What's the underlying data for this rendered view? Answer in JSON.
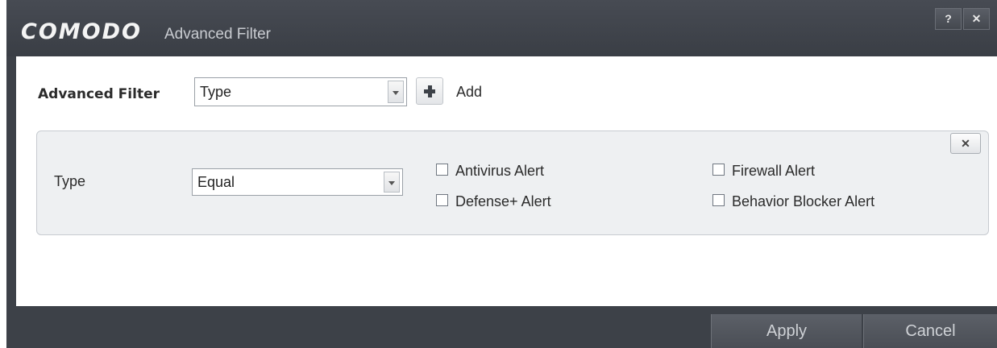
{
  "title": {
    "brand": "COMODO",
    "subtitle": "Advanced Filter",
    "help_label": "?",
    "close_label": "✕"
  },
  "filter": {
    "label": "Advanced Filter",
    "selected": "Type",
    "add_label": "Add"
  },
  "panel": {
    "close_label": "✕",
    "type_label": "Type",
    "operator": "Equal",
    "checkboxes": [
      {
        "label": "Antivirus Alert",
        "checked": false
      },
      {
        "label": "Defense+ Alert",
        "checked": false
      },
      {
        "label": "Firewall Alert",
        "checked": false
      },
      {
        "label": "Behavior Blocker Alert",
        "checked": false
      }
    ]
  },
  "footer": {
    "apply_label": "Apply",
    "cancel_label": "Cancel"
  },
  "icons": {
    "dropdown": "chevron-down-icon",
    "add": "plus-icon",
    "close": "close-icon",
    "help": "help-icon"
  }
}
